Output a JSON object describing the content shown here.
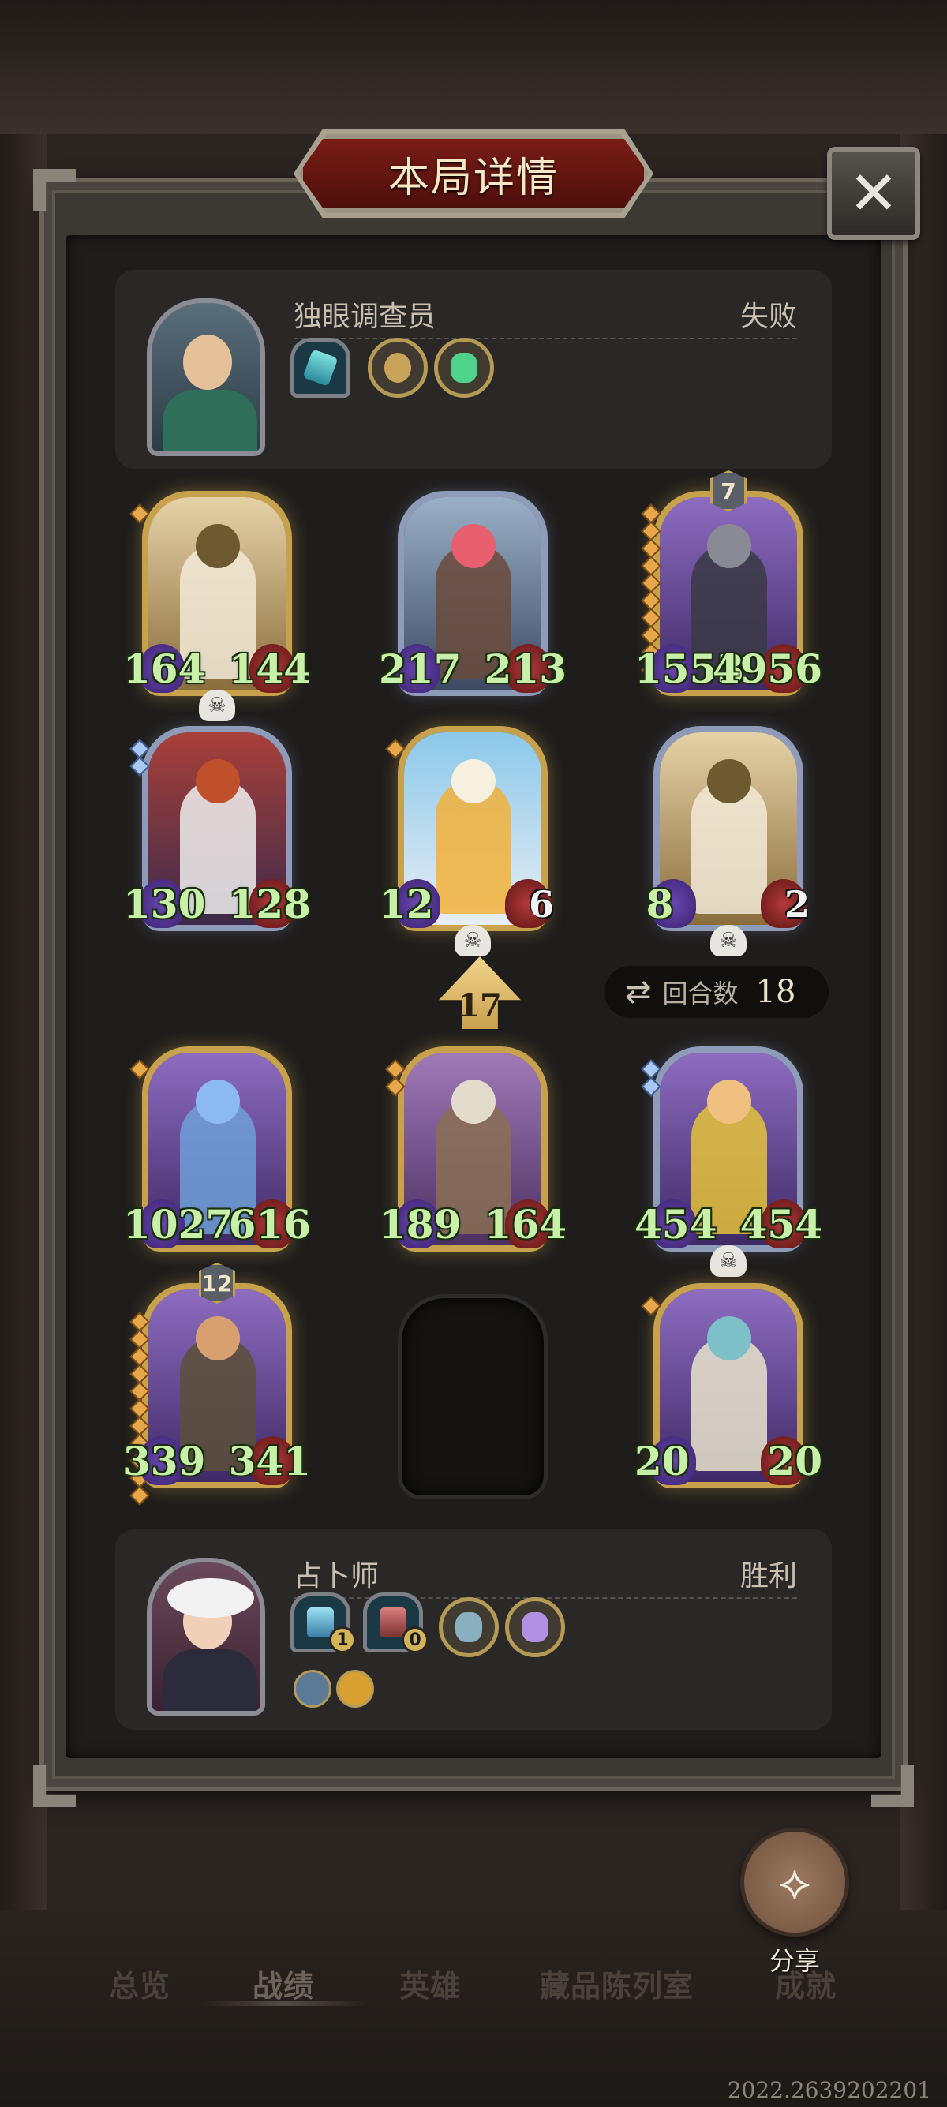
{
  "title": "本局详情",
  "close_label": "✕",
  "top_player": {
    "name": "独眼调查员",
    "result": "失败"
  },
  "bottom_player": {
    "name": "占卜师",
    "result": "胜利",
    "item_badges": [
      "1",
      "0"
    ]
  },
  "board": {
    "turns_label": "回合数",
    "turns_value": "18",
    "tavern_tier": "17",
    "minions": [
      {
        "id": "m1",
        "attack": "164",
        "health": "144",
        "deathrattle": true
      },
      {
        "id": "m2",
        "attack": "217",
        "health": "213"
      },
      {
        "id": "m3",
        "attack": "1553",
        "health": "4956",
        "badge": "7"
      },
      {
        "id": "m4",
        "attack": "130",
        "health": "128"
      },
      {
        "id": "m5",
        "attack": "12",
        "health": "6",
        "deathrattle": true
      },
      {
        "id": "m6",
        "attack": "8",
        "health": "2",
        "deathrattle": true
      },
      {
        "id": "m7",
        "attack": "1027",
        "health": "616"
      },
      {
        "id": "m8",
        "attack": "189",
        "health": "164"
      },
      {
        "id": "m9",
        "attack": "454",
        "health": "454",
        "deathrattle": true
      },
      {
        "id": "m10",
        "attack": "339",
        "health": "341",
        "badge": "12"
      },
      {
        "id": "m11",
        "attack": "20",
        "health": "20"
      }
    ]
  },
  "share_label": "分享",
  "nav": {
    "tabs": [
      "总览",
      "战绩",
      "英雄",
      "藏品陈列室",
      "成就"
    ],
    "active": "战绩"
  },
  "version": "2022.2639202201",
  "colors": {
    "stat_text": "#c9f0a8",
    "title_plate": "#7a1c16",
    "gold_frame": "#c8a14c"
  }
}
